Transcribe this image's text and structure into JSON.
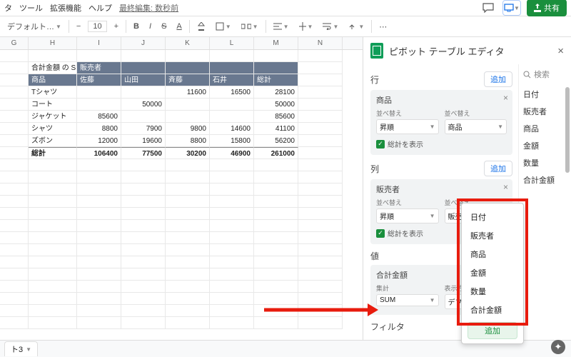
{
  "menus": [
    "タ",
    "ツール",
    "拡張機能",
    "ヘルプ"
  ],
  "last_edit": "最終編集: 数秒前",
  "share": "共有",
  "toolbar": {
    "font": "デフォルト…",
    "size": "10"
  },
  "cols": [
    "G",
    "H",
    "I",
    "J",
    "K",
    "L",
    "M",
    "N"
  ],
  "pivot": {
    "title_prefix": "合計金額 の SUM",
    "corner": "販売者",
    "row_head": "商品",
    "col_heads": [
      "佐藤",
      "山田",
      "斉藤",
      "石井",
      "総計"
    ],
    "rows": [
      {
        "label": "Tシャツ",
        "v": [
          "",
          "",
          "11600",
          "16500",
          "28100"
        ]
      },
      {
        "label": "コート",
        "v": [
          "",
          "50000",
          "",
          "",
          "50000"
        ]
      },
      {
        "label": "ジャケット",
        "v": [
          "85600",
          "",
          "",
          "",
          "85600"
        ]
      },
      {
        "label": "シャツ",
        "v": [
          "8800",
          "7900",
          "9800",
          "14600",
          "41100"
        ]
      },
      {
        "label": "ズボン",
        "v": [
          "12000",
          "19600",
          "8800",
          "15800",
          "56200"
        ]
      }
    ],
    "total_label": "総計",
    "totals": [
      "106400",
      "77500",
      "30200",
      "46900",
      "261000"
    ]
  },
  "editor": {
    "title": "ピボット テーブル エディタ",
    "search": "検索",
    "fields": [
      "日付",
      "販売者",
      "商品",
      "金額",
      "数量",
      "合計金額"
    ],
    "sections": {
      "rows": "行",
      "cols": "列",
      "values": "値",
      "filter": "フィルタ"
    },
    "add": "追加",
    "sort_label": "並べ替え",
    "order": "昇順",
    "by_label": "並べ替え",
    "show_totals": "総計を表示",
    "card_rows": {
      "name": "商品",
      "by": "商品"
    },
    "card_cols": {
      "name": "販売者",
      "by": "販売者"
    },
    "val": {
      "name": "合計金額",
      "agg_label": "集計",
      "agg": "SUM",
      "disp_label": "表示方法",
      "disp": "デフォルト"
    },
    "popup": [
      "日付",
      "販売者",
      "商品",
      "金額",
      "数量",
      "合計金額"
    ]
  },
  "tab_name": "ト3"
}
